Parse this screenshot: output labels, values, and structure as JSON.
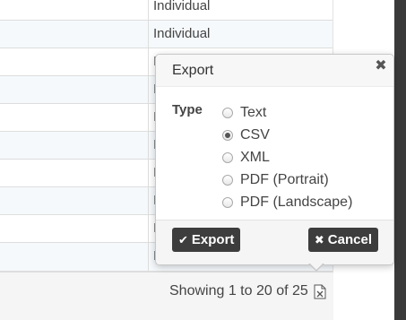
{
  "table": {
    "rows": [
      {
        "value": "Individual"
      },
      {
        "value": "Individual"
      },
      {
        "value": "I"
      },
      {
        "value": "I"
      },
      {
        "value": "I"
      },
      {
        "value": "I"
      },
      {
        "value": "I"
      },
      {
        "value": "I"
      },
      {
        "value": "I"
      },
      {
        "value": "I"
      }
    ]
  },
  "footer": {
    "pagination_text": "Showing 1 to 20 of 25",
    "export_icon": "file-excel-icon"
  },
  "export_popover": {
    "title": "Export",
    "close_icon": "close-icon",
    "type_label": "Type",
    "options": [
      {
        "label": "Text",
        "selected": false
      },
      {
        "label": "CSV",
        "selected": true
      },
      {
        "label": "XML",
        "selected": false
      },
      {
        "label": "PDF (Portrait)",
        "selected": false
      },
      {
        "label": "PDF (Landscape)",
        "selected": false
      }
    ],
    "export_button": {
      "label": "Export",
      "icon": "check-icon"
    },
    "cancel_button": {
      "label": "Cancel",
      "icon": "close-icon"
    }
  },
  "colors": {
    "button_bg": "#3d3d3d",
    "stripe_bg": "#f5f9fc",
    "scrollbar_bg": "#3a3a3a"
  }
}
